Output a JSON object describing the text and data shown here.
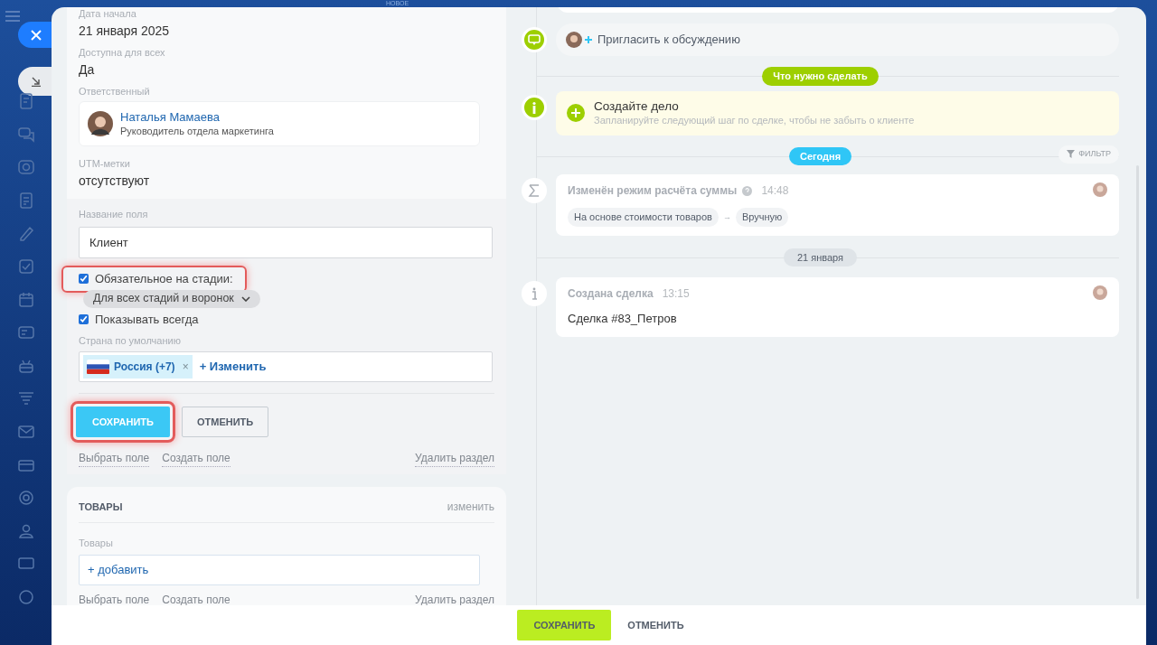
{
  "top_badge": "НОВОЕ",
  "details": {
    "fields": [
      {
        "label": "Дата начала",
        "value": "21 января 2025"
      },
      {
        "label": "Доступна для всех",
        "value": "Да"
      }
    ],
    "responsible": {
      "label": "Ответственный",
      "name": "Наталья Мамаева",
      "role": "Руководитель отдела маркетинга"
    },
    "utm": {
      "label": "UTM-метки",
      "value": "отсутствуют"
    }
  },
  "field_editor": {
    "name_label": "Название поля",
    "name_value": "Клиент",
    "options": [
      {
        "kind": "checkbox",
        "label": "Обязательное на стадии:",
        "checked": true,
        "highlighted": true
      },
      {
        "kind": "dropdown",
        "label": "Для всех стадий и воронок"
      },
      {
        "kind": "checkbox",
        "label": "Показывать всегда",
        "checked": true,
        "highlighted": false
      }
    ],
    "country_label": "Страна по умолчанию",
    "country_tag": "Россия (+7)",
    "tag_remove": "×",
    "change_link": "+ Изменить",
    "buttons": [
      {
        "kind": "primary",
        "label": "СОХРАНИТЬ",
        "highlighted": true
      },
      {
        "kind": "secondary",
        "label": "ОТМЕНИТЬ",
        "highlighted": false
      }
    ],
    "links": [
      "Выбрать поле",
      "Создать поле"
    ],
    "delete_link": "Удалить раздел"
  },
  "products": {
    "title": "ТОВАРЫ",
    "edit_link": "изменить",
    "field_label": "Товары",
    "add_link": "+ добавить",
    "links": [
      "Выбрать поле",
      "Создать поле"
    ],
    "delete_link": "Удалить раздел"
  },
  "timeline": {
    "invite": "Пригласить к обсуждению",
    "todo_pill": "Что нужно сделать",
    "create_task": {
      "title": "Создайте дело",
      "hint": "Запланируйте следующий шаг по сделке, чтобы не забыть о клиенте"
    },
    "today_pill": "Сегодня",
    "filter": "ФИЛЬТР",
    "events": [
      {
        "kind": "sum",
        "title": "Изменён режим расчёта суммы",
        "time": "14:48",
        "from": "На основе стоимости товаров",
        "arrow": "→",
        "to": "Вручную"
      },
      {
        "kind": "info",
        "date_pill": "21 января",
        "title": "Создана сделка",
        "time": "13:15",
        "text": "Сделка #83_Петров"
      }
    ]
  },
  "footer": {
    "buttons": [
      {
        "kind": "primary",
        "label": "СОХРАНИТЬ"
      },
      {
        "kind": "link",
        "label": "ОТМЕНИТЬ"
      }
    ]
  }
}
